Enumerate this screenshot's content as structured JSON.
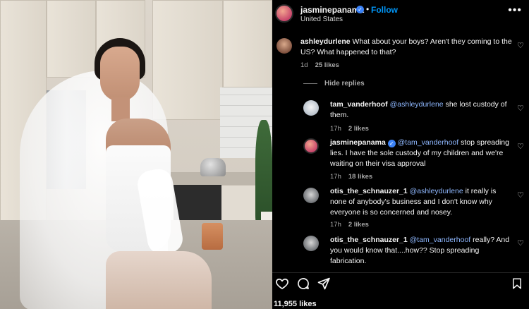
{
  "post": {
    "username": "jasminepanama",
    "follow_label": "Follow",
    "location": "United States",
    "likes": "11,955 likes"
  },
  "comments": [
    {
      "user": "ashleydurlene",
      "text": "What about your boys? Aren't they coming to the US? What happened to that?",
      "time": "1d",
      "likes": "25 likes"
    }
  ],
  "replies_toggle": "Hide replies",
  "replies": [
    {
      "user": "tam_vanderhoof",
      "mention": "@ashleydurlene",
      "text": "she lost custody of them.",
      "time": "17h",
      "likes": "2 likes"
    },
    {
      "user": "jasminepanama",
      "mention": "@tam_vanderhoof",
      "text": "stop spreading lies. I have the sole custody of my children and we're waiting on their visa approval",
      "time": "17h",
      "likes": "18 likes"
    },
    {
      "user": "otis_the_schnauzer_1",
      "mention": "@ashleydurlene",
      "text": "it really is none of anybody's business and I don't know why everyone is so concerned and nosey.",
      "time": "17h",
      "likes": "2 likes"
    },
    {
      "user": "otis_the_schnauzer_1",
      "mention": "@tam_vanderhoof",
      "text": "really? And you would know that....how?? Stop spreading fabrication."
    }
  ],
  "icons": {
    "more": "more-options-icon",
    "heart": "heart-icon",
    "comment": "comment-icon",
    "share": "share-icon",
    "save": "bookmark-icon",
    "verified": "verified-badge-icon"
  },
  "colors": {
    "background": "#000000",
    "accent": "#0095f6",
    "verified": "#3b82f6",
    "mention": "#8fb8ff",
    "muted": "#a8a8a8"
  }
}
